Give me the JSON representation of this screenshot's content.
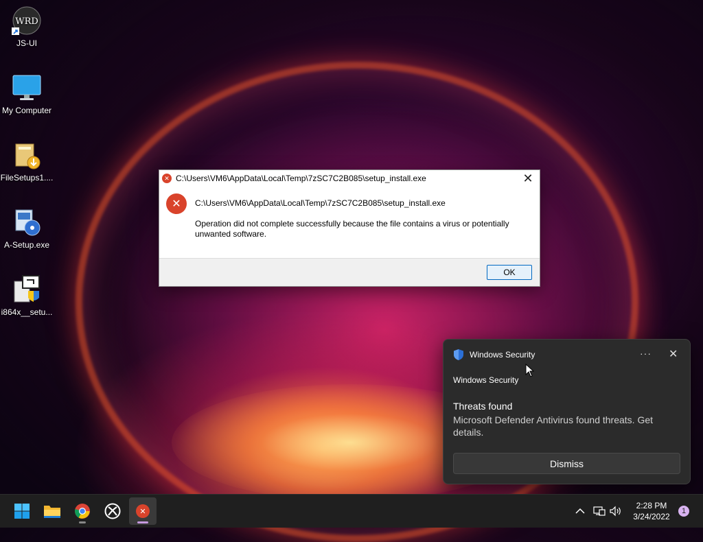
{
  "desktop": {
    "icons": [
      {
        "label": "JS-UI",
        "icon": "wrd-shortcut-icon"
      },
      {
        "label": "My Computer",
        "icon": "monitor-icon"
      },
      {
        "label": "FileSetups1....",
        "icon": "setup-box-icon"
      },
      {
        "label": "A-Setup.exe",
        "icon": "installer-cd-icon"
      },
      {
        "label": "i864x__setu...",
        "icon": "installer-shield-icon"
      }
    ],
    "icon_text_wrd": "WRD"
  },
  "dialog": {
    "title": "C:\\Users\\VM6\\AppData\\Local\\Temp\\7zSC7C2B085\\setup_install.exe",
    "path": "C:\\Users\\VM6\\AppData\\Local\\Temp\\7zSC7C2B085\\setup_install.exe",
    "message": "Operation did not complete successfully because the file contains a virus or potentially unwanted software.",
    "ok_label": "OK",
    "close_glyph": "✕",
    "error_glyph": "✕"
  },
  "toast": {
    "app_name": "Windows Security",
    "more_glyph": "···",
    "close_glyph": "✕",
    "source": "Windows Security",
    "title": "Threats found",
    "description": "Microsoft Defender Antivirus found threats. Get details.",
    "dismiss_label": "Dismiss",
    "accent": "#2b6fd6"
  },
  "taskbar": {
    "apps": [
      "start-icon",
      "file-explorer-icon",
      "chrome-icon",
      "xbox-icon",
      "error-app-icon"
    ],
    "tray": {
      "chevron_glyph": "^",
      "time": "2:28 PM",
      "date": "3/24/2022",
      "notification_count": "1"
    }
  }
}
